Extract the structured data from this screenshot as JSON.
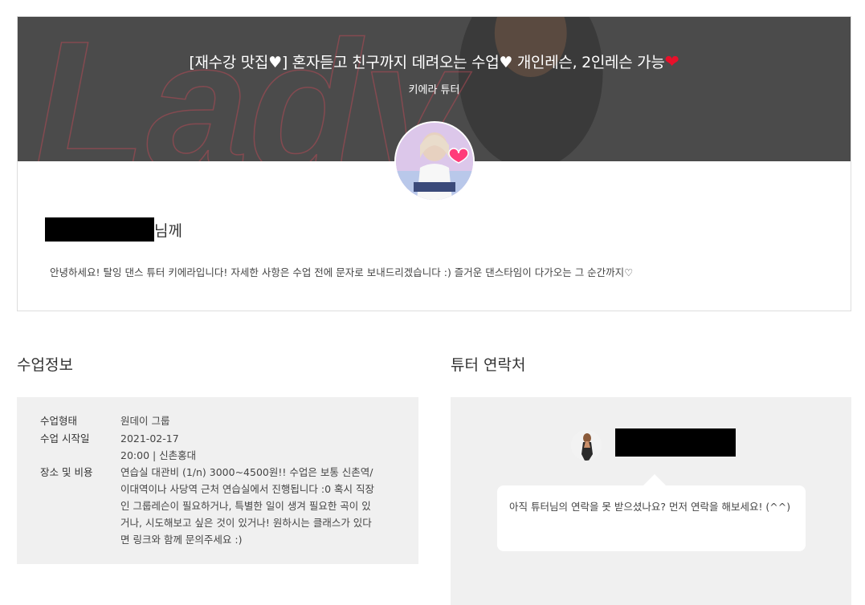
{
  "header": {
    "title_text": "[재수강 맛집♥] 혼자듣고 친구까지 데려오는 수업♥ 개인레슨, 2인레슨 가능",
    "title_heart": "❤",
    "tutor_name": "키에라 튜터",
    "background_word": "Lady"
  },
  "greeting": {
    "suffix": "님께",
    "message": "안녕하세요! 탈잉 댄스 튜터 키에라입니다! 자세한 사항은 수업 전에 문자로 보내드리겠습니다 :) 즐거운 댄스타임이 다가오는 그 순간까지♡"
  },
  "class_info": {
    "heading": "수업정보",
    "type_label": "수업형태",
    "type_value": "원데이 그룹",
    "start_label": "수업 시작일",
    "start_date": "2021-02-17",
    "start_time": "20:00 | 신촌홍대",
    "place_label": "장소 및 비용",
    "place_value": "연습실 대관비 (1/n) 3000~4500원!! 수업은 보통 신촌역/이대역이나 사당역 근처 연습실에서 진행됩니다 :0 혹시 직장인 그룹레슨이 필요하거나, 특별한 일이 생겨 필요한 곡이 있거나, 시도해보고 싶은 것이 있거나! 원하시는 클래스가 있다면 링크와 함께 문의주세요 :)"
  },
  "contact": {
    "heading": "튜터 연락처",
    "bubble_message": "아직 튜터님의 연락을 못 받으셨나요? 먼저 연락을 해보세요! (^^)"
  },
  "colors": {
    "banner_bg": "#4a4a4a",
    "panel_bg": "#f0f0f0",
    "heart_red": "#e8102a"
  }
}
